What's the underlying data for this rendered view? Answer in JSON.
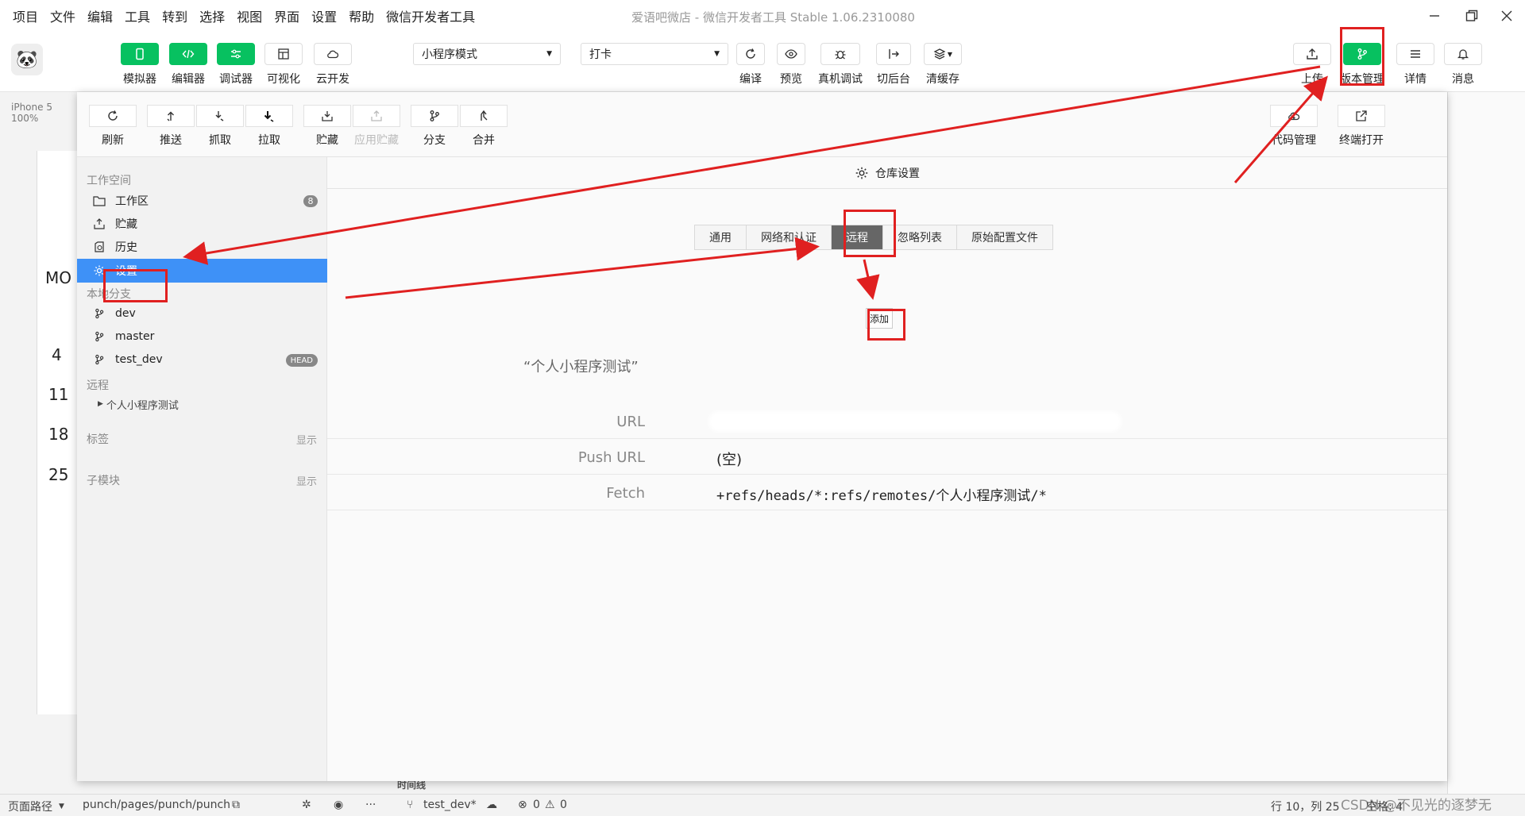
{
  "window": {
    "title": "爱语吧微店 - 微信开发者工具 Stable 1.06.2310080",
    "menus": [
      "项目",
      "文件",
      "编辑",
      "工具",
      "转到",
      "选择",
      "视图",
      "界面",
      "设置",
      "帮助",
      "微信开发者工具"
    ]
  },
  "toolbar": {
    "left_buttons": [
      {
        "label": "模拟器",
        "icon": "phone-icon"
      },
      {
        "label": "编辑器",
        "icon": "code-icon"
      },
      {
        "label": "调试器",
        "icon": "debug-icon"
      },
      {
        "label": "可视化",
        "icon": "layout-icon"
      },
      {
        "label": "云开发",
        "icon": "cloud-icon"
      }
    ],
    "mode_select": "小程序模式",
    "page_select": "打卡",
    "mid_buttons": [
      {
        "label": "编译",
        "icon": "refresh-icon"
      },
      {
        "label": "预览",
        "icon": "eye-icon"
      },
      {
        "label": "真机调试",
        "icon": "bug-icon"
      },
      {
        "label": "切后台",
        "icon": "switch-icon"
      },
      {
        "label": "清缓存",
        "icon": "layers-icon"
      }
    ],
    "right_buttons": [
      {
        "label": "上传",
        "icon": "upload-icon"
      },
      {
        "label": "版本管理",
        "icon": "branch-icon"
      },
      {
        "label": "详情",
        "icon": "menu-icon"
      },
      {
        "label": "消息",
        "icon": "bell-icon"
      }
    ]
  },
  "background": {
    "device": "iPhone 5 100%",
    "phone_header": "MO",
    "calendar_numbers": [
      "4",
      "11",
      "18",
      "25"
    ],
    "bottom_panel_label": "时间线"
  },
  "vcs": {
    "tools": [
      {
        "label": "刷新",
        "icon": "refresh-icon",
        "enabled": true
      },
      {
        "label": "推送",
        "icon": "push-icon",
        "enabled": true
      },
      {
        "label": "抓取",
        "icon": "fetch-icon",
        "enabled": true
      },
      {
        "label": "拉取",
        "icon": "pull-icon",
        "enabled": true
      },
      {
        "label": "贮藏",
        "icon": "stash-icon",
        "enabled": true
      },
      {
        "label": "应用贮藏",
        "icon": "apply-stash-icon",
        "enabled": false
      },
      {
        "label": "分支",
        "icon": "branch-icon",
        "enabled": true
      },
      {
        "label": "合并",
        "icon": "merge-icon",
        "enabled": true
      }
    ],
    "right_tools": [
      {
        "label": "代码管理",
        "icon": "cloud-code-icon"
      },
      {
        "label": "终端打开",
        "icon": "external-link-icon"
      }
    ],
    "sidebar": {
      "workspace_title": "工作空间",
      "workspace_items": [
        {
          "label": "工作区",
          "icon": "folder-icon",
          "badge": "8"
        },
        {
          "label": "贮藏",
          "icon": "stash-icon"
        },
        {
          "label": "历史",
          "icon": "history-icon"
        },
        {
          "label": "设置",
          "icon": "gear-icon",
          "active": true
        }
      ],
      "local_branches_title": "本地分支",
      "branches": [
        {
          "label": "dev"
        },
        {
          "label": "master"
        },
        {
          "label": "test_dev",
          "badge": "HEAD"
        }
      ],
      "remote_title": "远程",
      "remote_item": "个人小程序测试",
      "tags_title": "标签",
      "tags_action": "显示",
      "submodules_title": "子模块",
      "submodules_action": "显示"
    },
    "main": {
      "title": "仓库设置",
      "tabs": [
        {
          "label": "通用"
        },
        {
          "label": "网络和认证"
        },
        {
          "label": "远程",
          "active": true
        },
        {
          "label": "忽略列表"
        },
        {
          "label": "原始配置文件"
        }
      ],
      "add_button": "添加",
      "remote_name": "“个人小程序测试”",
      "fields": [
        {
          "key": "URL",
          "value": ""
        },
        {
          "key": "Push URL",
          "value": "(空)"
        },
        {
          "key": "Fetch",
          "value": "+refs/heads/*:refs/remotes/个人小程序测试/*"
        }
      ]
    }
  },
  "statusbar": {
    "page_path_label": "页面路径",
    "page_path": "punch/pages/punch/punch",
    "branch": "test_dev*",
    "errors": "0",
    "warnings": "0",
    "cursor": "行 10，列 25",
    "spaces": "空格: 4"
  },
  "watermark": "CSDN @不见光的逐梦无",
  "colors": {
    "accent_green": "#07c160",
    "active_blue": "#3e91f7",
    "annotation_red": "#e02020"
  }
}
